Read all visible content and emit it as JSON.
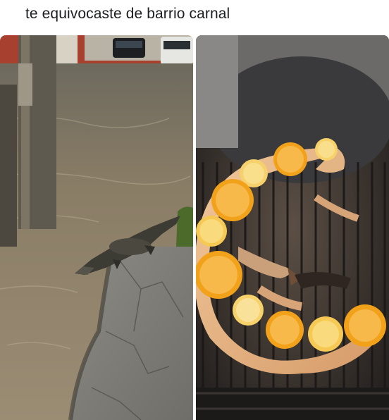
{
  "post": {
    "caption": "te equivocaste de barrio carnal"
  },
  "images": {
    "left": {
      "icon": "flooded-street-crocodile-photo"
    },
    "right": {
      "icon": "grilled-crocodile-with-oranges-photo"
    }
  },
  "colors": {
    "caption_text": "#1c1e21",
    "flood_water": "#8a7a62",
    "grill_fire": "#3a3434",
    "orange_slice": "#f2a21a"
  }
}
